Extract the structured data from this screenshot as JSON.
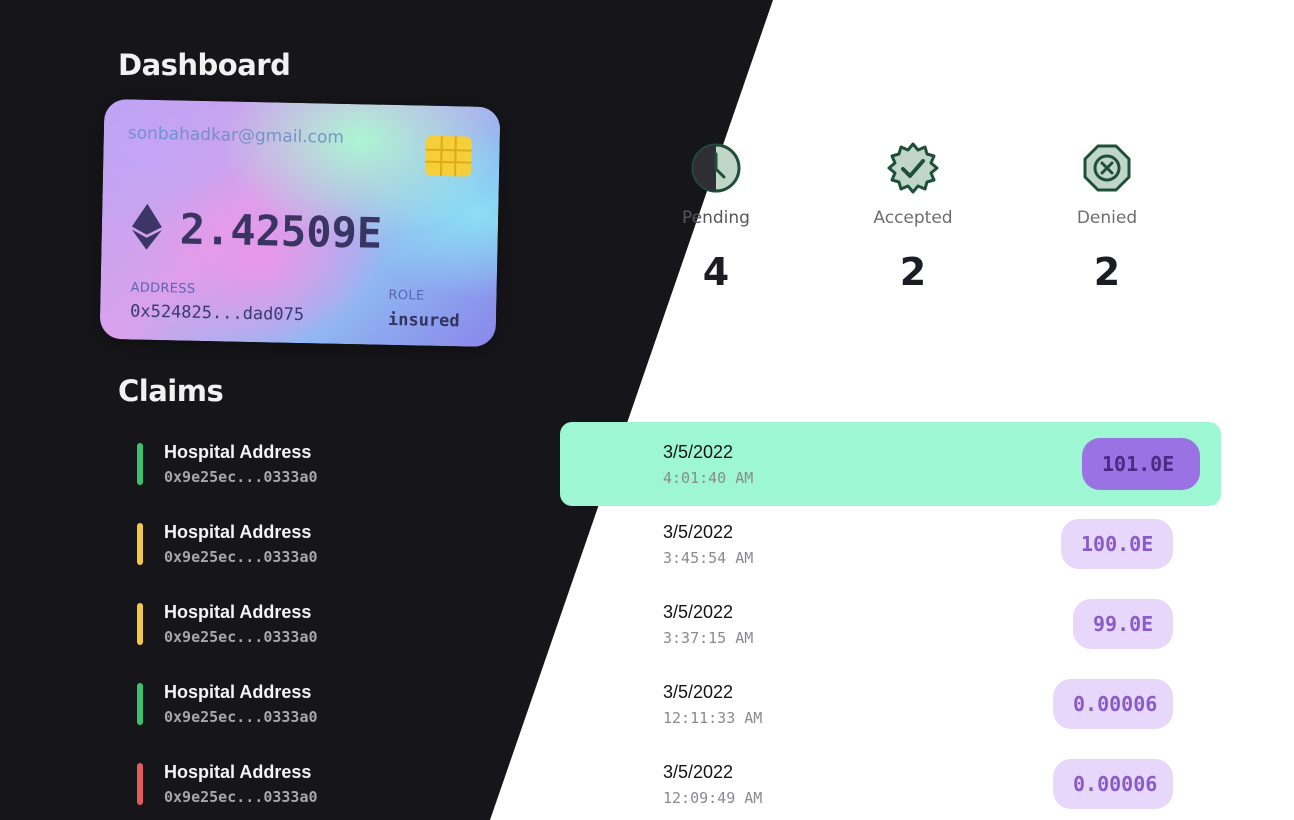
{
  "dashboard": {
    "title": "Dashboard"
  },
  "card": {
    "email": "sonbahadkar@gmail.com",
    "balance": "2.42509E",
    "address_label": "ADDRESS",
    "address": "0x524825...dad075",
    "role_label": "ROLE",
    "role": "insured",
    "eth_icon": "ethereum-icon",
    "chip_icon": "card-chip-icon"
  },
  "stats": {
    "pending": {
      "label": "Pending",
      "value": "4",
      "icon": "clock-icon"
    },
    "accepted": {
      "label": "Accepted",
      "value": "2",
      "icon": "check-badge-icon"
    },
    "denied": {
      "label": "Denied",
      "value": "2",
      "icon": "x-octagon-icon"
    }
  },
  "claims": {
    "title": "Claims",
    "items": [
      {
        "title": "Hospital Address",
        "address": "0x9e25ec...0333a0",
        "date": "3/5/2022",
        "time": "4:01:40 AM",
        "amount": "101.0E",
        "status": "accepted",
        "status_color": "#3fbf6e",
        "selected": true
      },
      {
        "title": "Hospital Address",
        "address": "0x9e25ec...0333a0",
        "date": "3/5/2022",
        "time": "3:45:54 AM",
        "amount": "100.0E",
        "status": "pending",
        "status_color": "#f0c84a",
        "selected": false
      },
      {
        "title": "Hospital Address",
        "address": "0x9e25ec...0333a0",
        "date": "3/5/2022",
        "time": "3:37:15 AM",
        "amount": "99.0E",
        "status": "pending",
        "status_color": "#f0c84a",
        "selected": false
      },
      {
        "title": "Hospital Address",
        "address": "0x9e25ec...0333a0",
        "date": "3/5/2022",
        "time": "12:11:33 AM",
        "amount": "0.00006",
        "status": "accepted",
        "status_color": "#3fbf6e",
        "selected": false
      },
      {
        "title": "Hospital Address",
        "address": "0x9e25ec...0333a0",
        "date": "3/5/2022",
        "time": "12:09:49 AM",
        "amount": "0.00006",
        "status": "denied",
        "status_color": "#e45b5b",
        "selected": false
      }
    ]
  },
  "colors": {
    "dark_bg": "#161519",
    "highlight_row": "#9df7d3",
    "icon_green": "#1f4f3b",
    "pill_bg": "#e6d7fb",
    "pill_active_bg": "#9b72e3"
  }
}
